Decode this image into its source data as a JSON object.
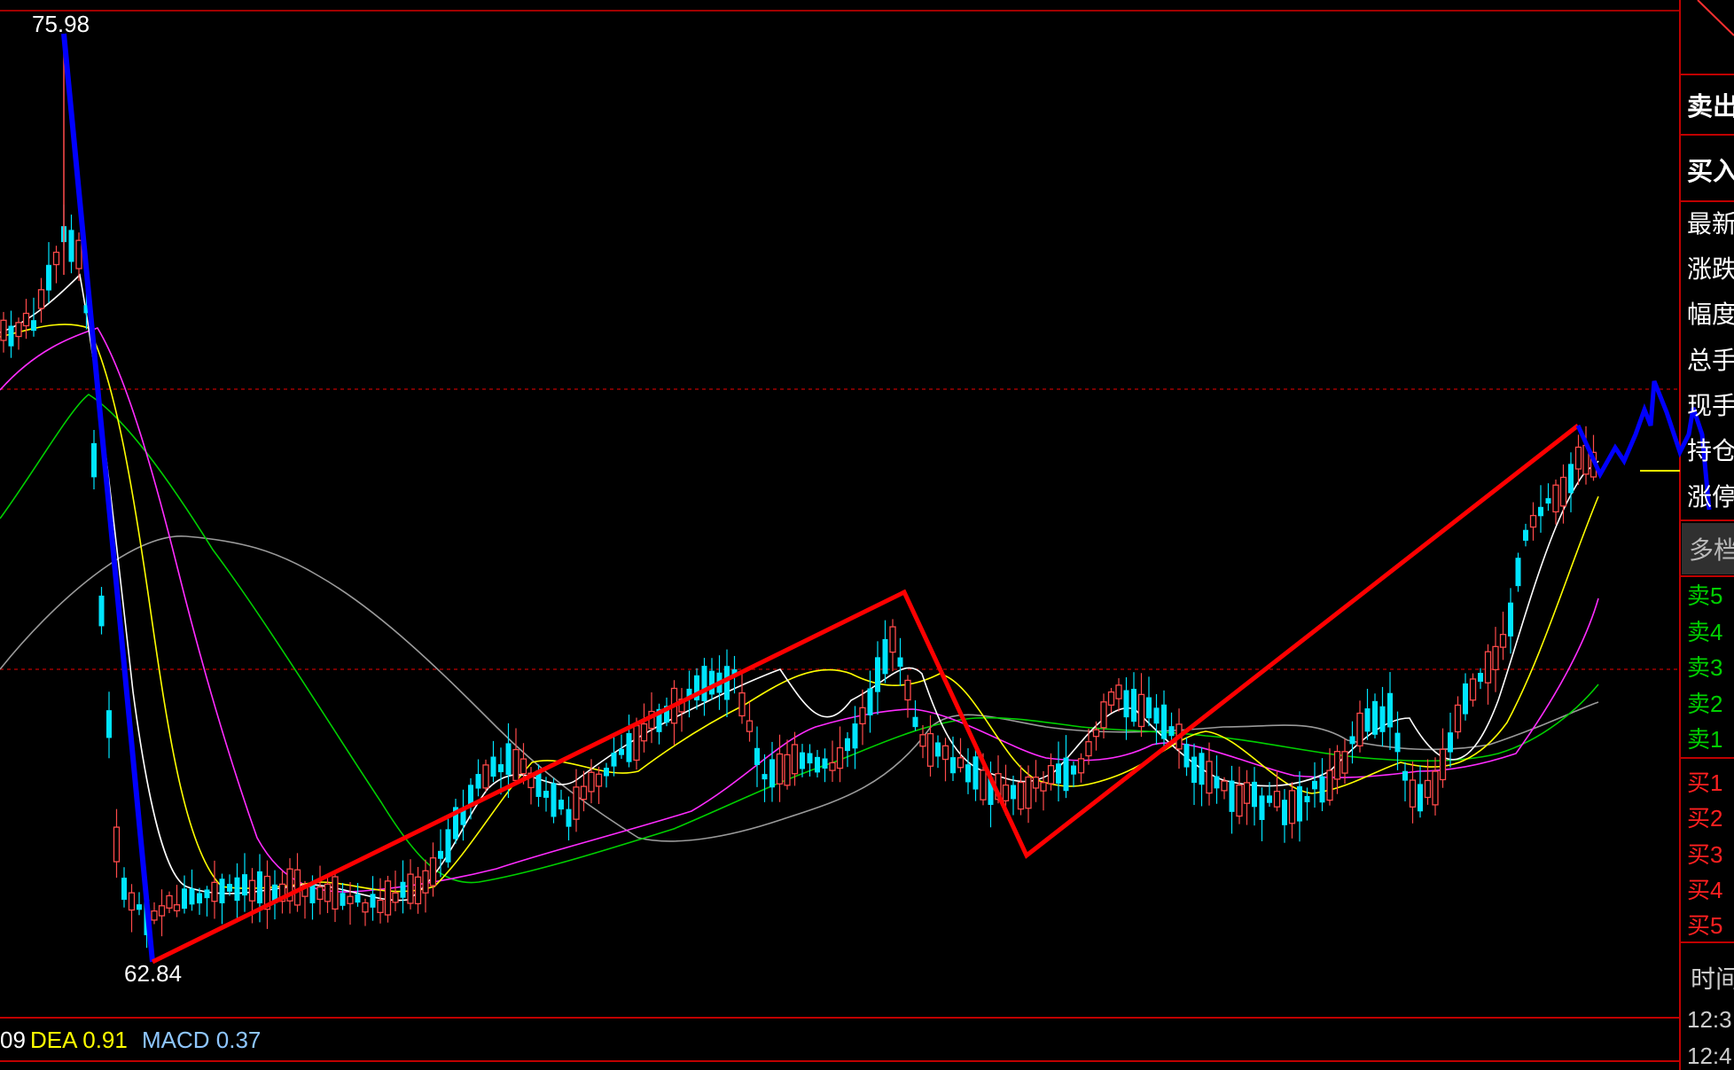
{
  "chart_data": {
    "type": "candlestick",
    "high_label": "75.98",
    "low_label": "62.84",
    "macd_labels": [
      {
        "text": "09",
        "color": "#ffffff"
      },
      {
        "text": "DEA 0.91",
        "color": "#ffff00"
      },
      {
        "text": "MACD 0.37",
        "color": "#8ec6ff"
      }
    ],
    "colors": {
      "up": "#ff4a4a",
      "down": "#00e5ff",
      "ma5": "#ffffff",
      "ma10": "#ffff00",
      "ma20": "#ff2cff",
      "ma30": "#00d000",
      "ma60": "#9a9a9a",
      "trend_red": "#ff0000",
      "trend_blue": "#0000ff",
      "grid_dotted": "#a00000",
      "border": "#c00000"
    }
  },
  "quote_panel": {
    "sell_label": "卖出",
    "buy_label": "买入",
    "fields": [
      "最新",
      "涨跌",
      "幅度",
      "总手",
      "现手",
      "持仓",
      "涨停"
    ],
    "tab": "多档",
    "sell_levels": [
      "卖5",
      "卖4",
      "卖3",
      "卖2",
      "卖1"
    ],
    "buy_levels": [
      "买1",
      "买2",
      "买3",
      "买4",
      "买5"
    ],
    "time_header": "时间",
    "times": [
      "12:3",
      "12:4"
    ]
  }
}
